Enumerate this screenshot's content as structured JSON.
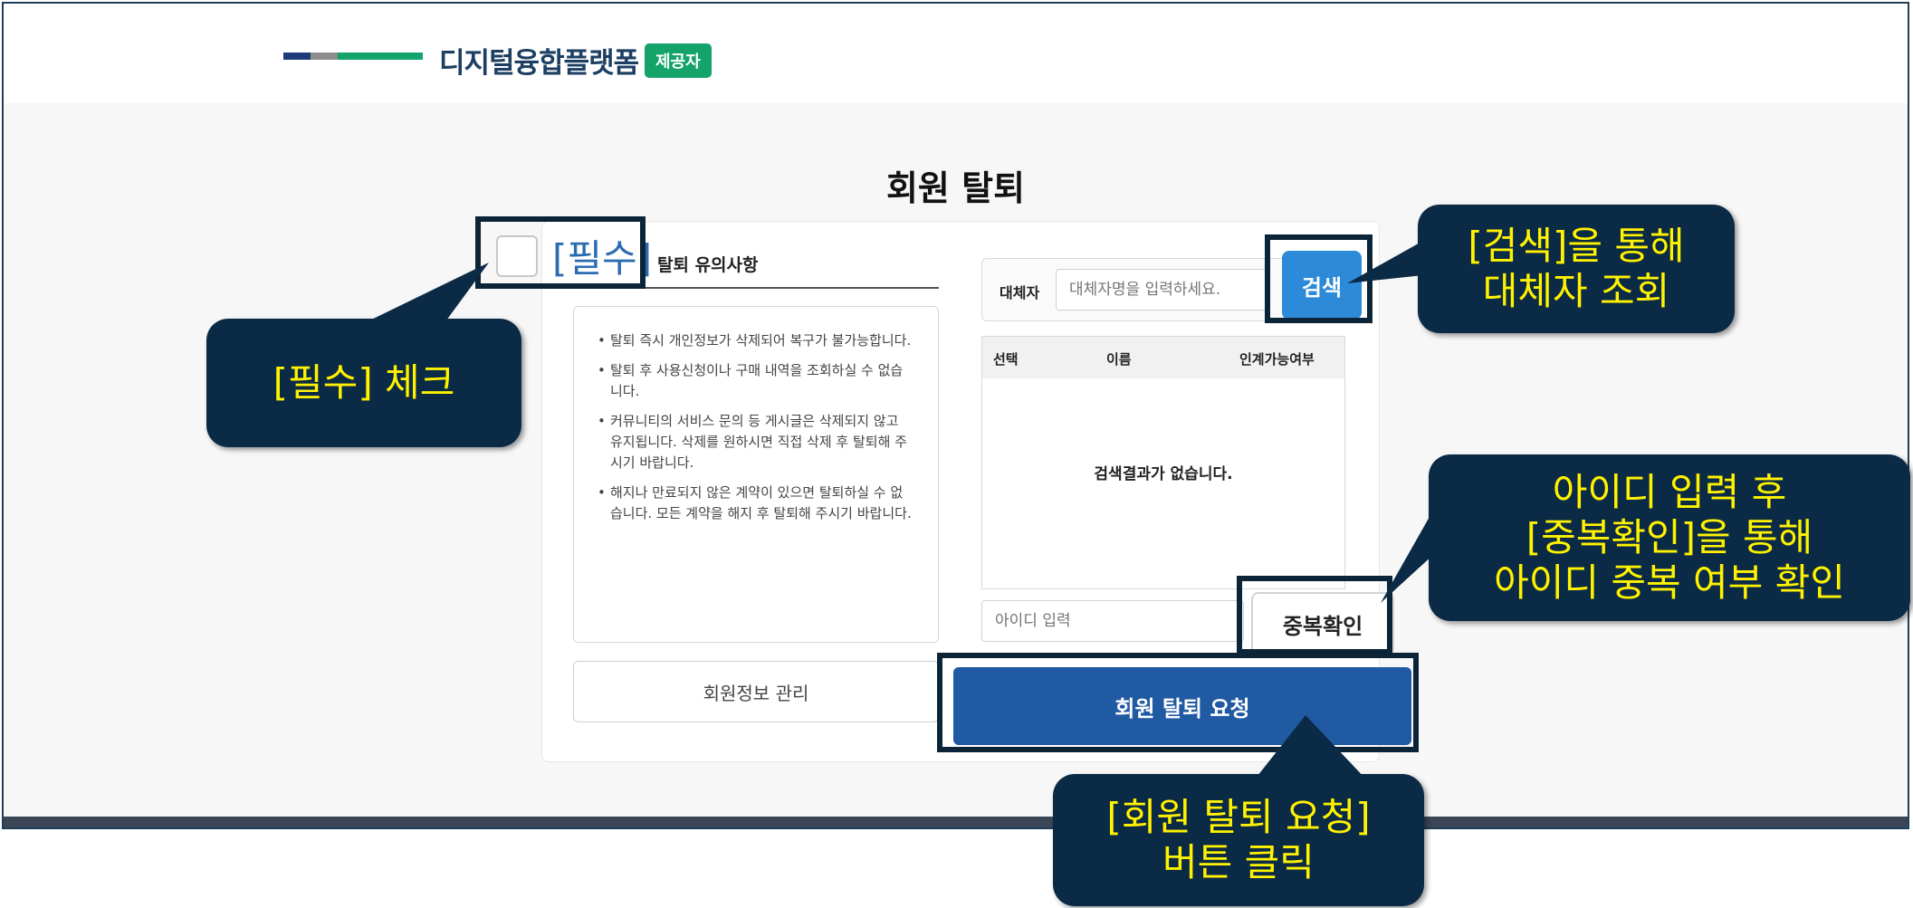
{
  "header": {
    "brand": "디지털융합플랫폼",
    "badge": "제공자",
    "bar_colors": [
      "#1c3a7a",
      "#8c8c8c",
      "#14a36b"
    ]
  },
  "page": {
    "title": "회원 탈퇴"
  },
  "notice": {
    "required_label": "[필수]",
    "title": "탈퇴 유의사항",
    "items": [
      "탈퇴 즉시 개인정보가 삭제되어 복구가 불가능합니다.",
      "탈퇴 후 사용신청이나 구매 내역을 조회하실 수 없습니다.",
      "커뮤니티의 서비스 문의 등 게시글은 삭제되지 않고 유지됩니다. 삭제를 원하시면 직접 삭제 후 탈퇴해 주시기 바랍니다.",
      "해지나 만료되지 않은 계약이 있으면 탈퇴하실 수 없습니다. 모든 계약을 해지 후 탈퇴해 주시기 바랍니다."
    ]
  },
  "substitute": {
    "label": "대체자",
    "placeholder": "대체자명을 입력하세요.",
    "search_button": "검색"
  },
  "table": {
    "columns": [
      "선택",
      "이름",
      "인계가능여부"
    ],
    "empty_text": "검색결과가 없습니다."
  },
  "id_check": {
    "placeholder": "아이디 입력",
    "button": "중복확인"
  },
  "buttons": {
    "member_info": "회원정보 관리",
    "withdraw_request": "회원 탈퇴 요청"
  },
  "callouts": {
    "required_check": "[필수] 체크",
    "search": [
      "[검색]을 통해",
      "대체자 조회"
    ],
    "duplicate": [
      "아이디 입력 후",
      "[중복확인]을 통해",
      "아이디 중복 여부 확인"
    ],
    "withdraw": [
      "[회원 탈퇴 요청]",
      "버튼 클릭"
    ]
  }
}
